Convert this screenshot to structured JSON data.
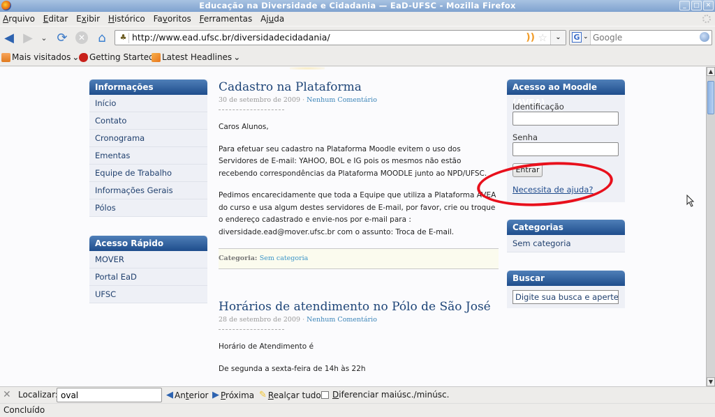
{
  "window": {
    "title": "Educação na Diversidade e Cidadania — EaD-UFSC - Mozilla Firefox",
    "controls": [
      "_",
      "□",
      "✕"
    ]
  },
  "menu": [
    {
      "pre": "",
      "u": "A",
      "post": "rquivo"
    },
    {
      "pre": "",
      "u": "E",
      "post": "ditar"
    },
    {
      "pre": "E",
      "u": "x",
      "post": "ibir"
    },
    {
      "pre": "",
      "u": "H",
      "post": "istórico"
    },
    {
      "pre": "Fa",
      "u": "v",
      "post": "oritos"
    },
    {
      "pre": "",
      "u": "F",
      "post": "erramentas"
    },
    {
      "pre": "Aj",
      "u": "u",
      "post": "da"
    }
  ],
  "navbar": {
    "url": "http://www.ead.ufsc.br/diversidadecidadania/",
    "search_placeholder": "Google",
    "search_engine_letter": "G"
  },
  "bookmarks": {
    "mais_visitados": "Mais visitados",
    "getting_started": "Getting Started",
    "latest_headlines": "Latest Headlines"
  },
  "sidebar_left": {
    "informacoes": {
      "title": "Informações",
      "items": [
        "Início",
        "Contato",
        "Cronograma",
        "Ementas",
        "Equipe de Trabalho",
        "Informações Gerais",
        "Pólos"
      ]
    },
    "acesso_rapido": {
      "title": "Acesso Rápido",
      "items": [
        "MOVER",
        "Portal EaD",
        "UFSC"
      ]
    }
  },
  "posts": [
    {
      "title": "Cadastro na Plataforma",
      "date": "30 de setembro de 2009",
      "separator": " · ",
      "comments": "Nenhum Comentário",
      "paragraphs": [
        "Caros Alunos,",
        "Para efetuar seu cadastro na Plataforma Moodle evitem o uso dos Servidores de E-mail: YAHOO, BOL e IG pois os mesmos não estão recebendo correspondências da Plataforma MOODLE junto ao NPD/UFSC.",
        "Pedimos encarecidamente que toda a Equipe que utiliza a Plataforma AVEA do curso e usa algum destes servidores de E-mail, por favor, crie ou troque o endereço cadastrado e envie-nos por e-mail para : diversidade.ead@mover.ufsc.br com o assunto: Troca de E-mail."
      ],
      "category_label": "Categoria:",
      "category": "Sem categoria"
    },
    {
      "title": "Horários de atendimento no Pólo de São José",
      "date": "28 de setembro de 2009",
      "separator": " · ",
      "comments": "Nenhum Comentário",
      "paragraphs": [
        "Horário de Atendimento é",
        "De segunda a sexta-feira de 14h às 22h"
      ]
    }
  ],
  "sidebar_right": {
    "moodle": {
      "title": "Acesso ao Moodle (AVEA)",
      "id_label": "Identificação",
      "id_value": "",
      "password_label": "Senha",
      "password_value": "",
      "submit": "Entrar",
      "help": "Necessita de ajuda?"
    },
    "categorias": {
      "title": "Categorias",
      "items": [
        "Sem categoria"
      ]
    },
    "buscar": {
      "title": "Buscar",
      "placeholder": "Digite sua busca e aperte Enter"
    }
  },
  "findbar": {
    "label": "Localizar:",
    "value": "oval",
    "prev": {
      "pre": "An",
      "u": "t",
      "post": "erior"
    },
    "next": {
      "pre": "",
      "u": "P",
      "post": "róxima"
    },
    "highlight": {
      "pre": "",
      "u": "R",
      "post": "ealçar tudo"
    },
    "match_case": {
      "pre": "",
      "u": "D",
      "post": "iferenciar maiúsc./minúsc."
    },
    "match_case_checked": false
  },
  "status": "Concluído",
  "annotation": {
    "color": "#e8101c",
    "shape": "ellipse",
    "target": "Necessita de ajuda?"
  }
}
